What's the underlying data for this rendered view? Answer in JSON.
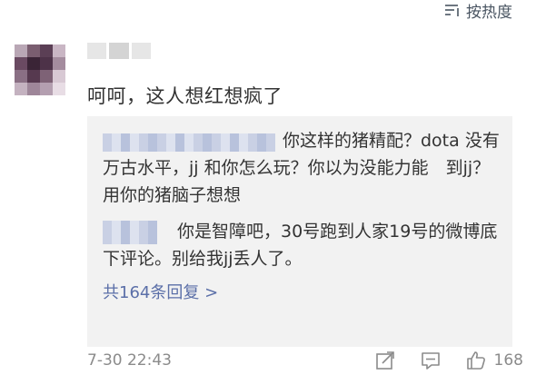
{
  "sort": {
    "label": "按热度",
    "icon": "sort-lines-icon"
  },
  "comment": {
    "avatar_icon": "blurred-avatar",
    "text": "呵呵，这人想红想疯了",
    "replies": [
      {
        "text": "你这样的猪精配？dota 没有万古水平，jj 和你怎么玩？你以为没能力能　到jj？用你的猪脑子想想"
      },
      {
        "text": "你是智障吧，30号跑到人家19号的微博底下评论。别给我jj丢人了。"
      }
    ],
    "reply_count": "共164条回复 >",
    "timestamp": "7-30 22:43",
    "likes": "168",
    "accent_color": "#5b6fa8"
  }
}
